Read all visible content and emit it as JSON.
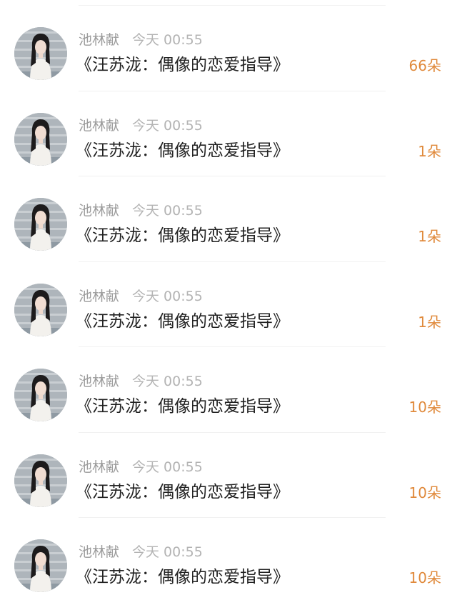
{
  "accent_color": "#e08a3c",
  "entries": [
    {
      "user": "池林献",
      "time": "今天 00:55",
      "title": "《汪苏泷：偶像的恋爱指导》",
      "count": "66朵",
      "avatar_icon": "user-avatar"
    },
    {
      "user": "池林献",
      "time": "今天 00:55",
      "title": "《汪苏泷：偶像的恋爱指导》",
      "count": "1朵",
      "avatar_icon": "user-avatar"
    },
    {
      "user": "池林献",
      "time": "今天 00:55",
      "title": "《汪苏泷：偶像的恋爱指导》",
      "count": "1朵",
      "avatar_icon": "user-avatar"
    },
    {
      "user": "池林献",
      "time": "今天 00:55",
      "title": "《汪苏泷：偶像的恋爱指导》",
      "count": "1朵",
      "avatar_icon": "user-avatar"
    },
    {
      "user": "池林献",
      "time": "今天 00:55",
      "title": "《汪苏泷：偶像的恋爱指导》",
      "count": "10朵",
      "avatar_icon": "user-avatar"
    },
    {
      "user": "池林献",
      "time": "今天 00:55",
      "title": "《汪苏泷：偶像的恋爱指导》",
      "count": "10朵",
      "avatar_icon": "user-avatar"
    },
    {
      "user": "池林献",
      "time": "今天 00:55",
      "title": "《汪苏泷：偶像的恋爱指导》",
      "count": "10朵",
      "avatar_icon": "user-avatar"
    }
  ]
}
